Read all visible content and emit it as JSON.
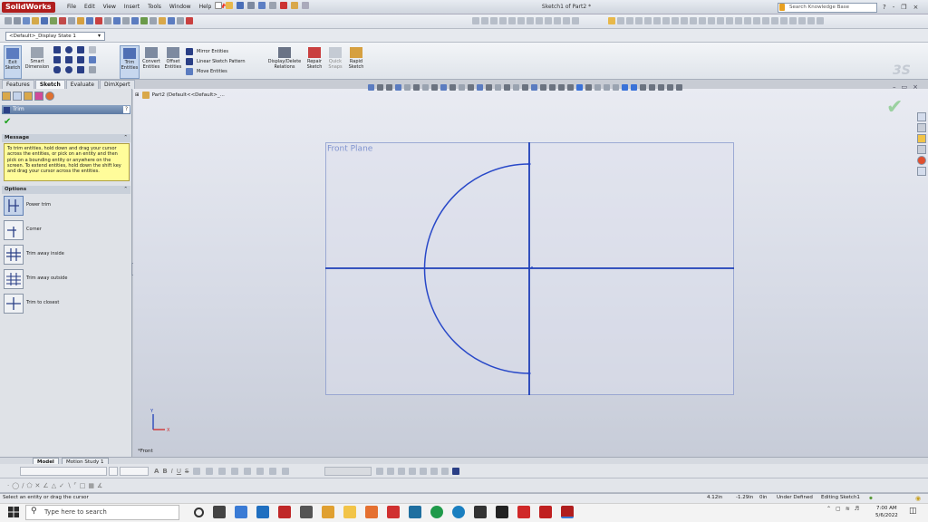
{
  "app": {
    "logo": "SolidWorks",
    "menus": [
      "File",
      "Edit",
      "View",
      "Insert",
      "Tools",
      "Window",
      "Help"
    ],
    "window_title": "Sketch1 of Part2 *",
    "search_placeholder": "Search Knowledge Base",
    "window_controls": [
      "?",
      "-",
      "❐",
      "×"
    ]
  },
  "config_dropdown": "<Default>_Display State 1",
  "command_manager": {
    "buttons": [
      "Exit Sketch",
      "Smart Dimension",
      "Trim Entities",
      "Convert Entities",
      "Offset Entities",
      "Display/Delete Relations",
      "Repair Sketch",
      "Quick Snaps",
      "Rapid Sketch"
    ],
    "pattern_items": [
      "Mirror Entities",
      "Linear Sketch Pattern",
      "Move Entities"
    ]
  },
  "tabs": [
    "Features",
    "Sketch",
    "Evaluate",
    "DimXpert"
  ],
  "property_manager": {
    "title": "Trim",
    "help": "?",
    "message_header": "Message",
    "message": "To trim entities, hold down and drag your cursor across the entities, or pick on an entity and then pick on a bounding entity or anywhere on the screen.  To extend entities, hold down the shift key and drag your cursor across the entities.",
    "options_header": "Options",
    "options": [
      "Power trim",
      "Corner",
      "Trim away inside",
      "Trim away outside",
      "Trim to closest"
    ]
  },
  "graphics": {
    "tree_label": "Part2  (Default<<Default>_...",
    "plane_label": "Front Plane",
    "view_label": "*Front",
    "axis_labels": [
      "Y",
      "X"
    ]
  },
  "bottom_tabs": [
    "Model",
    "Motion Study 1"
  ],
  "status": {
    "left": "Select an entity or drag the cursor",
    "x": "4.12in",
    "y": "-1.29in",
    "z": "0in",
    "state": "Under Defined",
    "mode": "Editing Sketch1"
  },
  "taskbar": {
    "search_placeholder": "Type here to search",
    "time": "7:00 AM",
    "date": "5/6/2022"
  },
  "colors": {
    "sketch_line": "#1f3fb8",
    "plane_border": "#7d8fc4",
    "plane_label": "#7f93cf",
    "message_bg": "#fffc9a"
  }
}
